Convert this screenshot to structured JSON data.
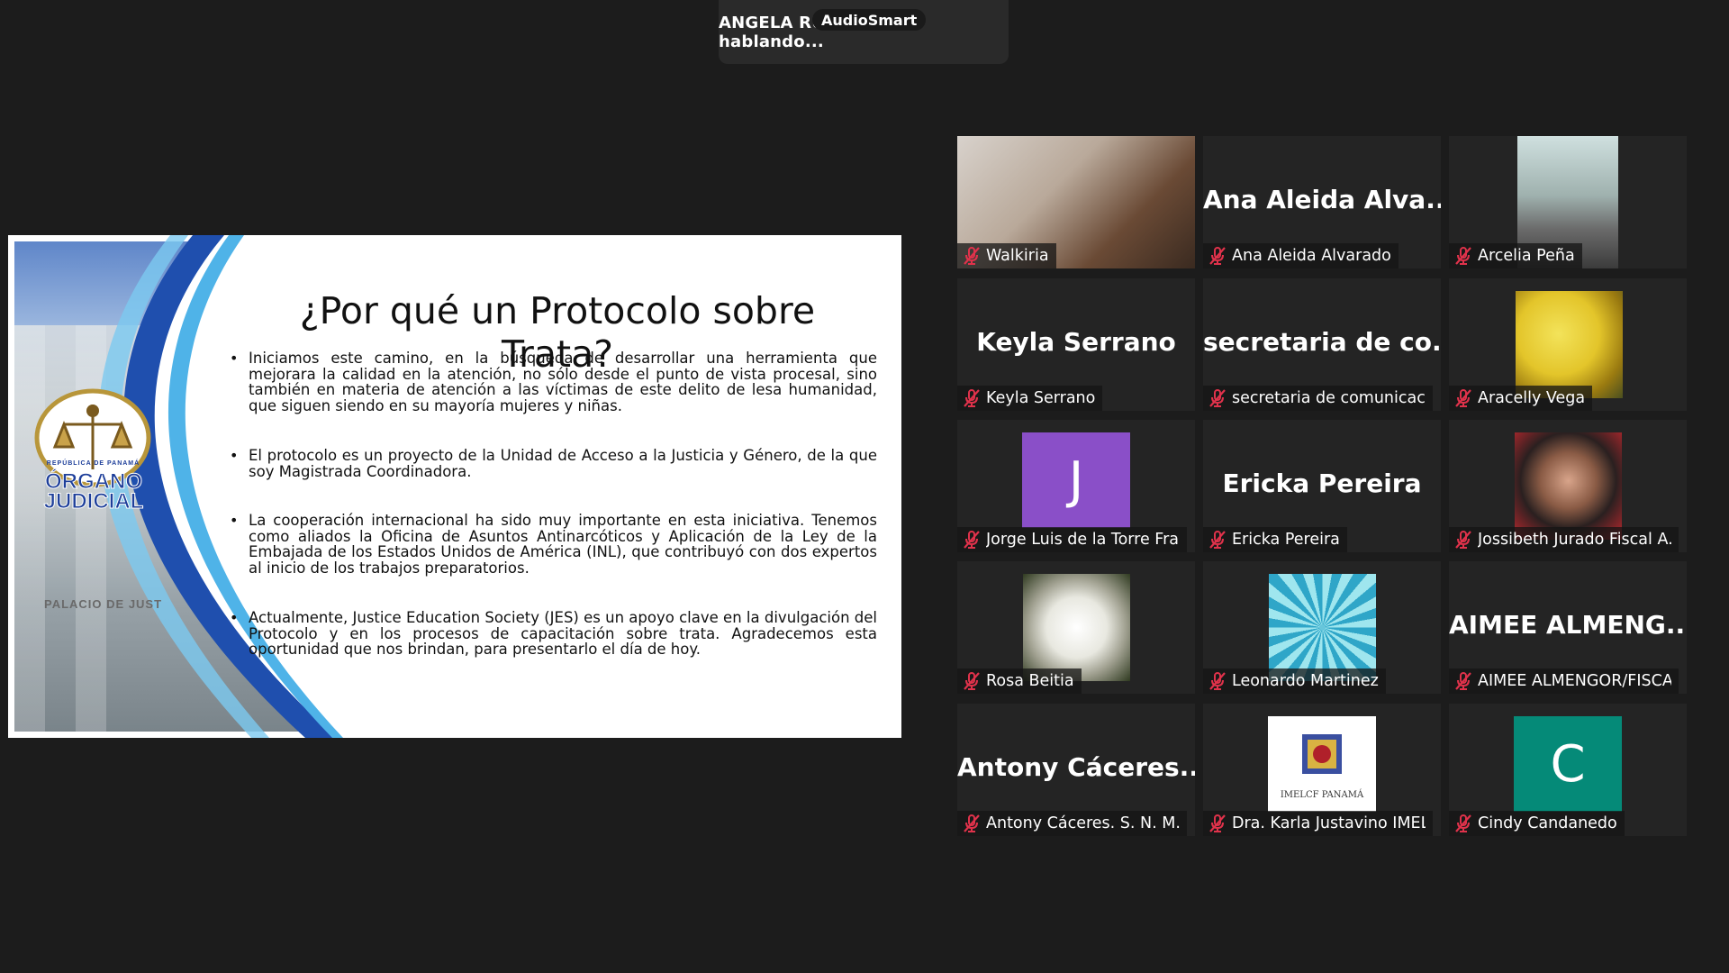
{
  "speaking": {
    "text": "ANGELA RUSSO está hablando...",
    "badge": "AudioSmart"
  },
  "slide": {
    "title": "¿Por qué un Protocolo sobre Trata?",
    "logo_top": "REPÚBLICA DE PANAMÁ",
    "logo_line1": "ÓRGANO",
    "logo_line2": "JUDICIAL",
    "building_caption": "PALACIO DE JUST",
    "bullets": [
      "Iniciamos este camino, en la búsqueda de desarrollar una herramienta que mejorara la calidad en la atención, no sólo desde el punto de vista procesal, sino también en materia de atención a las víctimas de este delito de lesa humanidad, que siguen siendo en su mayoría mujeres y niñas.",
      "El protocolo es un proyecto de la Unidad de Acceso a la Justicia y Género, de la que soy Magistrada Coordinadora.",
      "La cooperación internacional ha sido muy importante en esta iniciativa. Tenemos como aliados la Oficina de Asuntos Antinarcóticos y Aplicación de la Ley de la Embajada de los Estados Unidos de América (INL), que contribuyó con dos expertos al inicio de los trabajos preparatorios.",
      "Actualmente, Justice Education Society (JES) es un apoyo clave en la divulgación del Protocolo y en los procesos de capacitación sobre trata. Agradecemos esta oportunidad que nos brindan, para presentarlo el día de hoy."
    ]
  },
  "participants": [
    {
      "label": "Walkiria",
      "display": "",
      "kind": "video"
    },
    {
      "label": "Ana Aleida Alvarado",
      "display": "Ana Aleida Alva...",
      "kind": "name"
    },
    {
      "label": "Arcelia Peña",
      "display": "",
      "kind": "video"
    },
    {
      "label": "Keyla Serrano",
      "display": "Keyla Serrano",
      "kind": "name"
    },
    {
      "label": "secretaria de comunicaci...",
      "display": "secretaria de co...",
      "kind": "name"
    },
    {
      "label": "Aracelly Vega",
      "display": "",
      "kind": "image"
    },
    {
      "label": "Jorge Luis de la Torre Fra...",
      "display": "J",
      "kind": "avatar",
      "color": "#8a4fc8"
    },
    {
      "label": "Ericka Pereira",
      "display": "Ericka Pereira",
      "kind": "name"
    },
    {
      "label": "Jossibeth Jurado Fiscal A...",
      "display": "",
      "kind": "image"
    },
    {
      "label": "Rosa Beitia",
      "display": "",
      "kind": "image"
    },
    {
      "label": "Leonardo Martinez",
      "display": "",
      "kind": "image"
    },
    {
      "label": "AIMEE ALMENGOR/FISCA...",
      "display": "AIMEE ALMENG...",
      "kind": "name"
    },
    {
      "label": "Antony Cáceres. S. N. M. ...",
      "display": "Antony Cáceres...",
      "kind": "name"
    },
    {
      "label": "Dra. Karla Justavino IMEL...",
      "display": "IMELCF PANAMÁ",
      "kind": "logo"
    },
    {
      "label": "Cindy Candanedo",
      "display": "C",
      "kind": "avatar",
      "color": "#058a78"
    }
  ],
  "icons": {
    "muted": "mic-muted-icon"
  },
  "colors": {
    "background": "#1c1c1c",
    "tile": "#242424",
    "muted_red": "#e0324b"
  }
}
